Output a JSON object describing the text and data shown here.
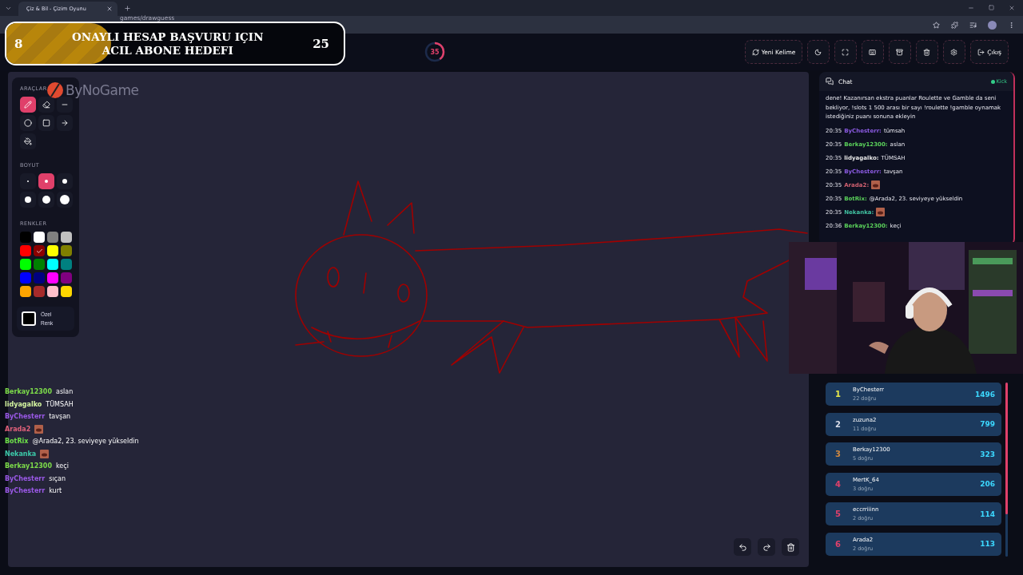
{
  "browser": {
    "tab_title": "Çiz & Bil - Çizim Oyunu",
    "url": "games/drawguess"
  },
  "banner": {
    "current": "8",
    "lines": [
      "ONAYLI HESAP BAŞVURU IÇIN",
      "ACIL ABONE HEDEFI"
    ],
    "target": "25",
    "level": 0.31
  },
  "timer": {
    "value": "35",
    "level": 0.4
  },
  "header_buttons": [
    {
      "kind": "refresh",
      "label": "Yeni Kelime"
    },
    {
      "kind": "moon"
    },
    {
      "kind": "expand"
    },
    {
      "kind": "keyboard"
    },
    {
      "kind": "archive"
    },
    {
      "kind": "trash"
    },
    {
      "kind": "settings"
    },
    {
      "kind": "logout",
      "label": "Çıkış"
    }
  ],
  "tools": {
    "title": "ARAÇLAR",
    "items": [
      {
        "kind": "pen",
        "selected": true
      },
      {
        "kind": "eraser",
        "selected": false
      },
      {
        "kind": "line",
        "selected": false
      },
      {
        "kind": "circle",
        "selected": false
      },
      {
        "kind": "rect",
        "selected": false
      },
      {
        "kind": "arrow",
        "selected": false
      },
      {
        "kind": "fill",
        "selected": false
      }
    ]
  },
  "sizes": {
    "title": "BOYUT",
    "items": [
      {
        "selected": false
      },
      {
        "selected": true
      },
      {
        "selected": false
      },
      {
        "selected": false
      },
      {
        "selected": false
      },
      {
        "selected": false
      }
    ]
  },
  "colors": {
    "title": "RENKLER",
    "items": [
      {
        "color": "#000000",
        "selected": false
      },
      {
        "color": "#ffffff",
        "selected": false
      },
      {
        "color": "#808080",
        "selected": false
      },
      {
        "color": "#c0c0c0",
        "selected": false
      },
      {
        "color": "#ff0000",
        "selected": false
      },
      {
        "color": "#8b0000",
        "selected": true
      },
      {
        "color": "#ffff00",
        "selected": false
      },
      {
        "color": "#808000",
        "selected": false
      },
      {
        "color": "#00ff00",
        "selected": false
      },
      {
        "color": "#008000",
        "selected": false
      },
      {
        "color": "#00ffff",
        "selected": false
      },
      {
        "color": "#008080",
        "selected": false
      },
      {
        "color": "#0000ff",
        "selected": false
      },
      {
        "color": "#000080",
        "selected": false
      },
      {
        "color": "#ff00ff",
        "selected": false
      },
      {
        "color": "#800080",
        "selected": false
      },
      {
        "color": "#ffa500",
        "selected": false
      },
      {
        "color": "#a52a2a",
        "selected": false
      },
      {
        "color": "#ffc0cb",
        "selected": false
      },
      {
        "color": "#ffd700",
        "selected": false
      }
    ]
  },
  "custom_color": {
    "label": "Özel Renk"
  },
  "logo": {
    "text": "ByNoGame"
  },
  "stream_chat": [
    {
      "kind": "text",
      "user": "Berkay12300",
      "color": "#7ddc4a",
      "text": "aslan"
    },
    {
      "kind": "text",
      "user": "lidyagalko",
      "color": "#d4f5a0",
      "text": "TÜMSAH"
    },
    {
      "kind": "text",
      "user": "ByChesterr",
      "color": "#9b59e8",
      "text": "tavşan"
    },
    {
      "kind": "emote",
      "user": "Arada2",
      "color": "#e0607a"
    },
    {
      "kind": "text",
      "user": "BotRix",
      "color": "#6ee04a",
      "text": "@Arada2, 23. seviyeye yükseldin"
    },
    {
      "kind": "emote",
      "user": "Nekanka",
      "color": "#3cc8a8"
    },
    {
      "kind": "text",
      "user": "Berkay12300",
      "color": "#7ddc4a",
      "text": "keçi"
    },
    {
      "kind": "text",
      "user": "ByChesterr",
      "color": "#9b59e8",
      "text": "sıçan"
    },
    {
      "kind": "text",
      "user": "ByChesterr",
      "color": "#9b59e8",
      "text": "kurt"
    }
  ],
  "chat": {
    "title": "Chat",
    "source": "Kick",
    "notice": "dene! Kazanırsan ekstra puanlar Roulette ve Gamble da seni bekliyor, !slots 1 500 arası bir sayı !roulette !gamble oynamak istediğiniz puanı sonuna ekleyin",
    "messages": [
      {
        "kind": "text",
        "time": "20:35",
        "user": "ByChesterr:",
        "color": "#8a5ae0",
        "text": "tümsah"
      },
      {
        "kind": "text",
        "time": "20:35",
        "user": "Berkay12300:",
        "color": "#5ad05a",
        "text": "aslan"
      },
      {
        "kind": "text",
        "time": "20:35",
        "user": "lidyagalko:",
        "color": "#e8e8e8",
        "text": "TÜMSAH"
      },
      {
        "kind": "text",
        "time": "20:35",
        "user": "ByChesterr:",
        "color": "#8a5ae0",
        "text": "tavşan"
      },
      {
        "kind": "emote",
        "time": "20:35",
        "user": "Arada2:",
        "color": "#d06070"
      },
      {
        "kind": "text",
        "time": "20:35",
        "user": "BotRix:",
        "color": "#5ad05a",
        "text": "@Arada2, 23. seviyeye yükseldin"
      },
      {
        "kind": "emote",
        "time": "20:35",
        "user": "Nekanka:",
        "color": "#40c0a0"
      },
      {
        "kind": "text",
        "time": "20:36",
        "user": "Berkay12300:",
        "color": "#5ad05a",
        "text": "keçi"
      }
    ]
  },
  "leaderboard": [
    {
      "rank": "1",
      "name": "ByChesterr",
      "correct": "22 doğru",
      "score": "1496",
      "color": "#e8e84a"
    },
    {
      "rank": "2",
      "name": "zuzuna2",
      "correct": "11 doğru",
      "score": "799",
      "color": "#d8dce8"
    },
    {
      "rank": "3",
      "name": "Berkay12300",
      "correct": "5 doğru",
      "score": "323",
      "color": "#d08840"
    },
    {
      "rank": "4",
      "name": "MertK_64",
      "correct": "3 doğru",
      "score": "206",
      "color": "#e0406a"
    },
    {
      "rank": "5",
      "name": "eccrriiinn",
      "correct": "2 doğru",
      "score": "114",
      "color": "#e0406a"
    },
    {
      "rank": "6",
      "name": "Arada2",
      "correct": "2 doğru",
      "score": "113",
      "color": "#e0406a"
    }
  ],
  "canvas_tools": [
    {
      "kind": "undo"
    },
    {
      "kind": "redo"
    },
    {
      "kind": "trash"
    }
  ]
}
